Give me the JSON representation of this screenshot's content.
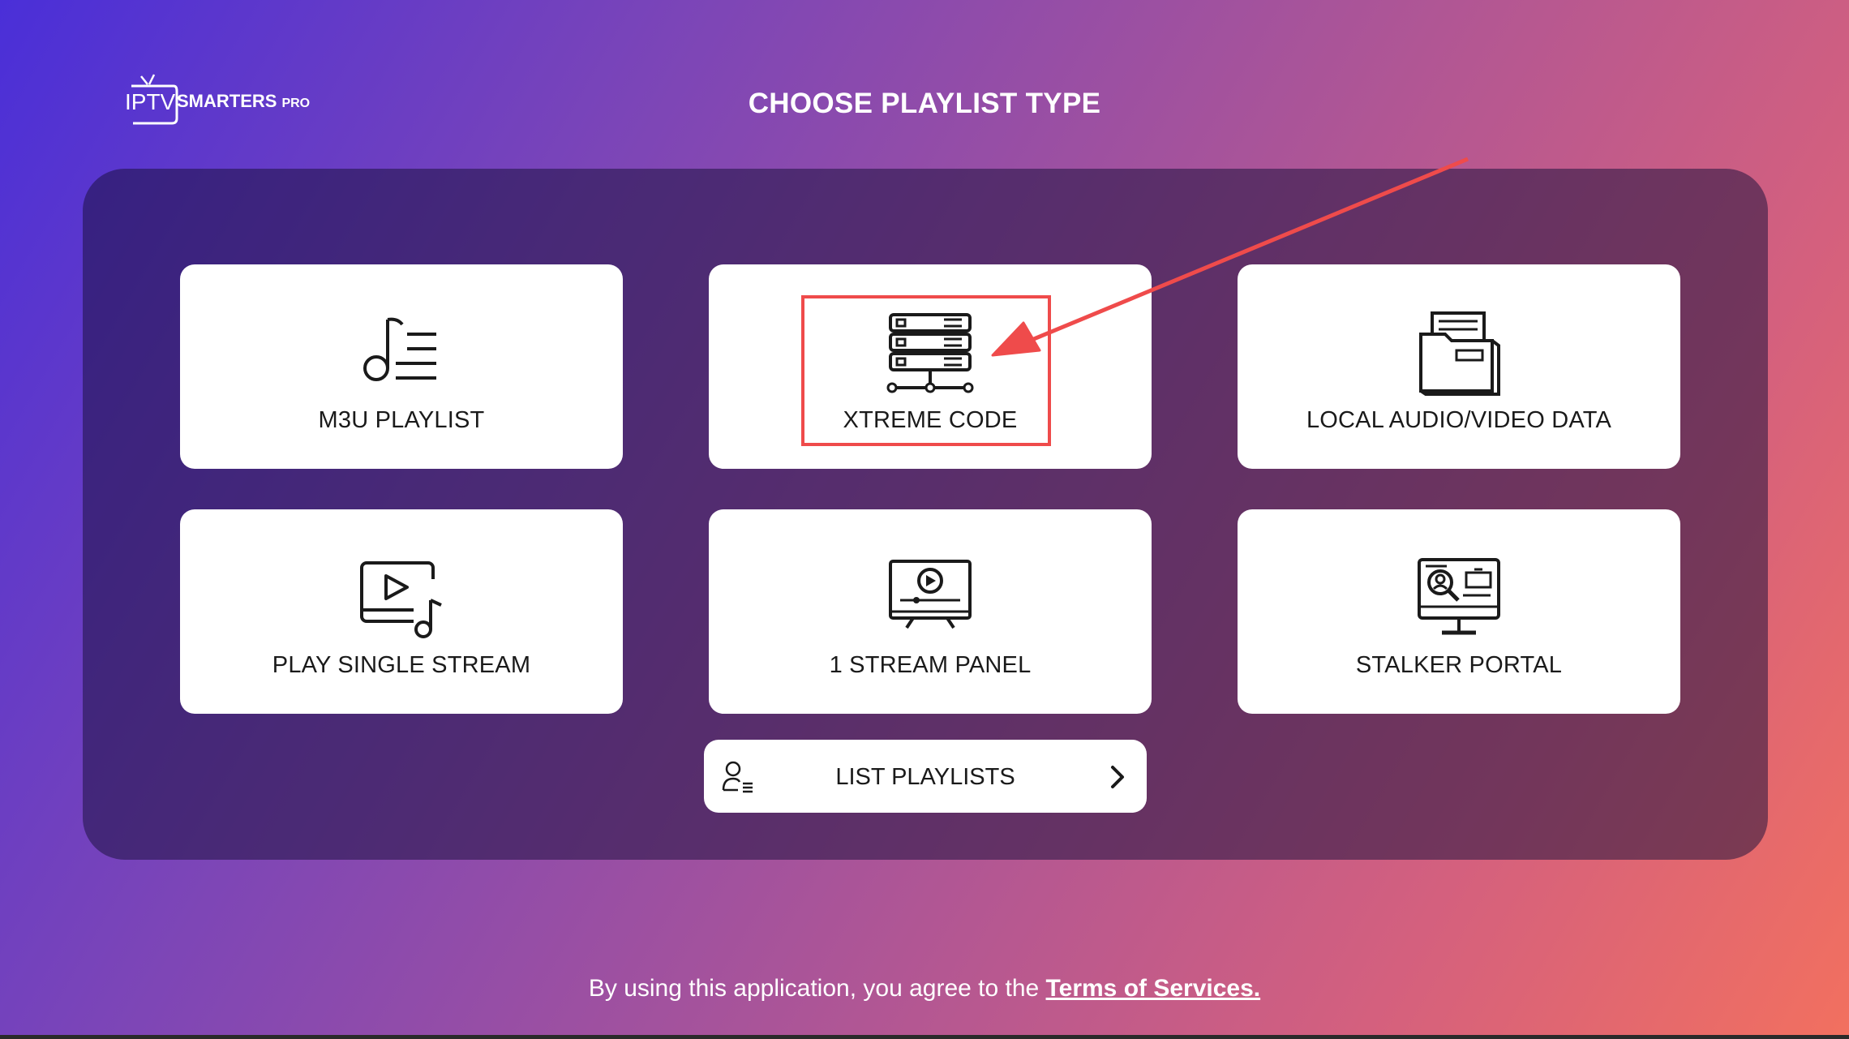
{
  "logo": {
    "iptv": "IPTV",
    "brand": "SMARTERS",
    "pro": "PRO"
  },
  "title": "CHOOSE PLAYLIST TYPE",
  "cards": [
    {
      "label": "M3U PLAYLIST",
      "icon": "music-list-icon"
    },
    {
      "label": "XTREME CODE",
      "icon": "server-stack-icon"
    },
    {
      "label": "LOCAL AUDIO/VIDEO DATA",
      "icon": "folder-documents-icon"
    },
    {
      "label": "PLAY SINGLE STREAM",
      "icon": "video-music-icon"
    },
    {
      "label": "1 STREAM PANEL",
      "icon": "tv-play-icon"
    },
    {
      "label": "STALKER PORTAL",
      "icon": "monitor-search-icon"
    }
  ],
  "list_playlists": {
    "label": "LIST PLAYLISTS",
    "icon": "user-list-icon",
    "chevron": "chevron-right-icon"
  },
  "footer": {
    "text": "By using this application, you agree to the ",
    "link": "Terms of Services."
  },
  "colors": {
    "highlight": "#ef4b4b",
    "annotation_arrow": "#ef4b4b",
    "card_bg": "#ffffff",
    "text_dark": "#1a1a1a"
  }
}
